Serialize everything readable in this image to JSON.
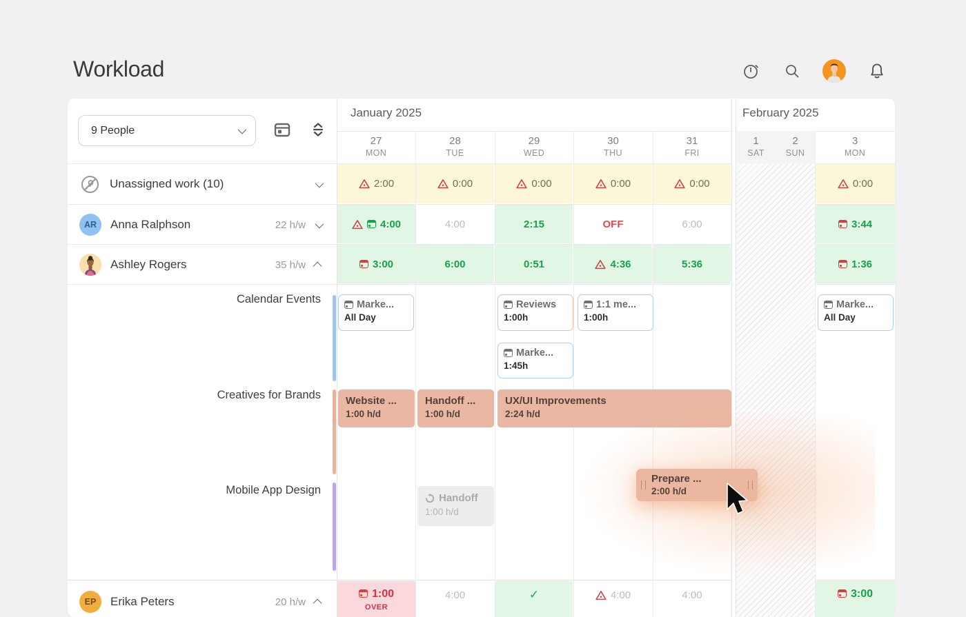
{
  "page": {
    "title": "Workload"
  },
  "toolbar": {
    "people_selector_value": "9 People"
  },
  "months": {
    "jan": "January 2025",
    "feb": "February 2025"
  },
  "days": [
    {
      "num": "27",
      "dow": "MON"
    },
    {
      "num": "28",
      "dow": "TUE"
    },
    {
      "num": "29",
      "dow": "WED"
    },
    {
      "num": "30",
      "dow": "THU"
    },
    {
      "num": "31",
      "dow": "FRI"
    },
    {
      "num": "1",
      "dow": "SAT"
    },
    {
      "num": "2",
      "dow": "SUN"
    },
    {
      "num": "3",
      "dow": "MON"
    }
  ],
  "unassigned": {
    "label": "Unassigned work (10)",
    "cells": {
      "mon": "2:00",
      "tue": "0:00",
      "wed": "0:00",
      "thu": "0:00",
      "fri": "0:00",
      "mon3": "0:00"
    }
  },
  "anna": {
    "name": "Anna Ralphson",
    "initials": "AR",
    "hours": "22 h/w",
    "cells": {
      "mon": "4:00",
      "tue": "4:00",
      "wed": "2:15",
      "thu": "OFF",
      "fri": "6:00",
      "mon3": "3:44"
    }
  },
  "ashley": {
    "name": "Ashley Rogers",
    "hours": "35 h/w",
    "cells": {
      "mon": "3:00",
      "tue": "6:00",
      "wed": "0:51",
      "thu": "4:36",
      "fri": "5:36",
      "mon3": "1:36"
    }
  },
  "erika": {
    "name": "Erika Peters",
    "initials": "EP",
    "hours": "20 h/w",
    "cells": {
      "mon": "1:00",
      "mon_sub": "OVER",
      "tue": "4:00",
      "wed": "✓",
      "thu": "4:00",
      "fri": "4:00",
      "mon3": "3:00"
    }
  },
  "sections": {
    "calendar_events": {
      "label": "Calendar Events",
      "events": [
        {
          "title": "Marke...",
          "time": "All Day"
        },
        {
          "title": "Reviews",
          "time": "1:00h"
        },
        {
          "title": "1:1 me...",
          "time": "1:00h"
        },
        {
          "title": "Marke...",
          "time": "1:45h"
        },
        {
          "title": "Marke...",
          "time": "All Day"
        }
      ]
    },
    "creatives": {
      "label": "Creatives for Brands",
      "bars": [
        {
          "title": "Website ...",
          "rate": "1:00 h/d"
        },
        {
          "title": "Handoff ...",
          "rate": "1:00 h/d"
        },
        {
          "title": "UX/UI Improvements",
          "rate": "2:24 h/d"
        }
      ]
    },
    "mobile": {
      "label": "Mobile App Design",
      "ghost": {
        "title": "Handoff",
        "rate": "1:00 h/d"
      },
      "drag": {
        "title": "Prepare ...",
        "rate": "2:00 h/d"
      }
    }
  },
  "colors": {
    "accent_green": "#17a149",
    "accent_red": "#d92f44",
    "warning_red": "#cc4444",
    "yellow_cell": "#fcf7d9",
    "green_cell": "#e2f6e5",
    "pink_cell": "#fbd8dc",
    "salmon_bar": "#e9b7a2",
    "blue_event_border": "#aecdf3",
    "salmon_event_border": "#e7bca9",
    "section_blue": "#9fc5ee",
    "section_salmon": "#e6b49e",
    "section_purple": "#b9a6ec",
    "avatar_orange": "#f5941f"
  }
}
